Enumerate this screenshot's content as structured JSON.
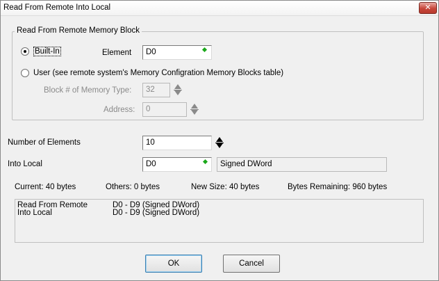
{
  "window": {
    "title": "Read From Remote Into Local",
    "close_label": "✕"
  },
  "group": {
    "legend": "Read From Remote Memory Block",
    "builtin": {
      "label": "Built-In",
      "checked": true
    },
    "element_label": "Element",
    "element_value": "D0",
    "user": {
      "label": "User (see remote system's Memory Configration Memory Blocks table)",
      "checked": false
    },
    "block_label": "Block # of Memory Type:",
    "block_value": "32",
    "address_label": "Address:",
    "address_value": "0"
  },
  "num_elements": {
    "label": "Number of Elements",
    "value": "10"
  },
  "into_local": {
    "label": "Into Local",
    "value": "D0",
    "type": "Signed DWord"
  },
  "stats": {
    "current": "Current:  40 bytes",
    "others": "Others:  0 bytes",
    "new_size": "New Size:  40 bytes",
    "remaining": "Bytes Remaining:  960 bytes"
  },
  "summary": [
    {
      "label": "Read From Remote",
      "value": "D0 - D9 (Signed DWord)"
    },
    {
      "label": "Into Local",
      "value": "D0 - D9 (Signed DWord)"
    }
  ],
  "buttons": {
    "ok": "OK",
    "cancel": "Cancel"
  },
  "colors": {
    "valid_indicator": "#1aa81a",
    "close_button": "#c7463a"
  }
}
